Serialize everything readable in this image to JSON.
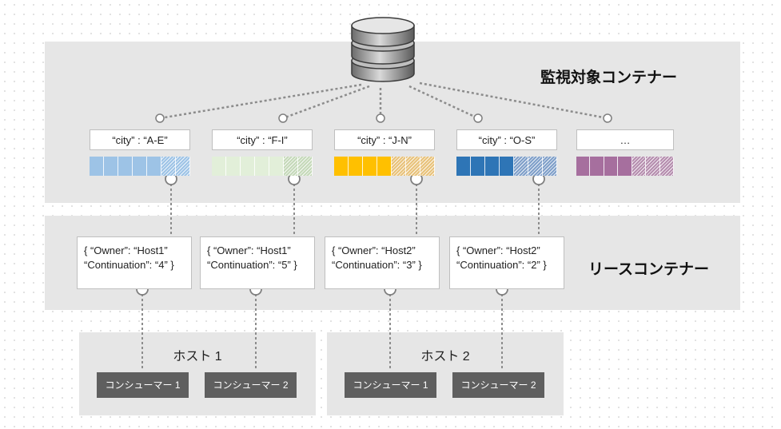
{
  "monitored_container": {
    "label": "監視対象コンテナー",
    "partitions": [
      {
        "key": "“city” : “A-E”",
        "color": "#9dc3e6"
      },
      {
        "key": "“city” : “F-I”",
        "color": "#e2efd9"
      },
      {
        "key": "“city” : “J-N”",
        "color": "#ffc000"
      },
      {
        "key": "“city” : “O-S”",
        "color": "#2e75b6"
      },
      {
        "key": "…",
        "color": "#a66f9e"
      }
    ]
  },
  "lease_container": {
    "label": "リースコンテナー",
    "leases": [
      {
        "line1": "{ “Owner”: “Host1”",
        "line2": "“Continuation”: “4” }"
      },
      {
        "line1": "{ “Owner”: “Host1”",
        "line2": "“Continuation”: “5” }"
      },
      {
        "line1": "{ “Owner”: “Host2”",
        "line2": "“Continuation”: “3” }"
      },
      {
        "line1": "{ “Owner”: “Host2”",
        "line2": "“Continuation”: “2” }"
      }
    ]
  },
  "hosts": [
    {
      "label": "ホスト 1",
      "consumers": [
        "コンシューマー 1",
        "コンシューマー 2"
      ]
    },
    {
      "label": "ホスト 2",
      "consumers": [
        "コンシューマー 1",
        "コンシューマー 2"
      ]
    }
  ],
  "icons": {
    "database": "database-icon"
  }
}
